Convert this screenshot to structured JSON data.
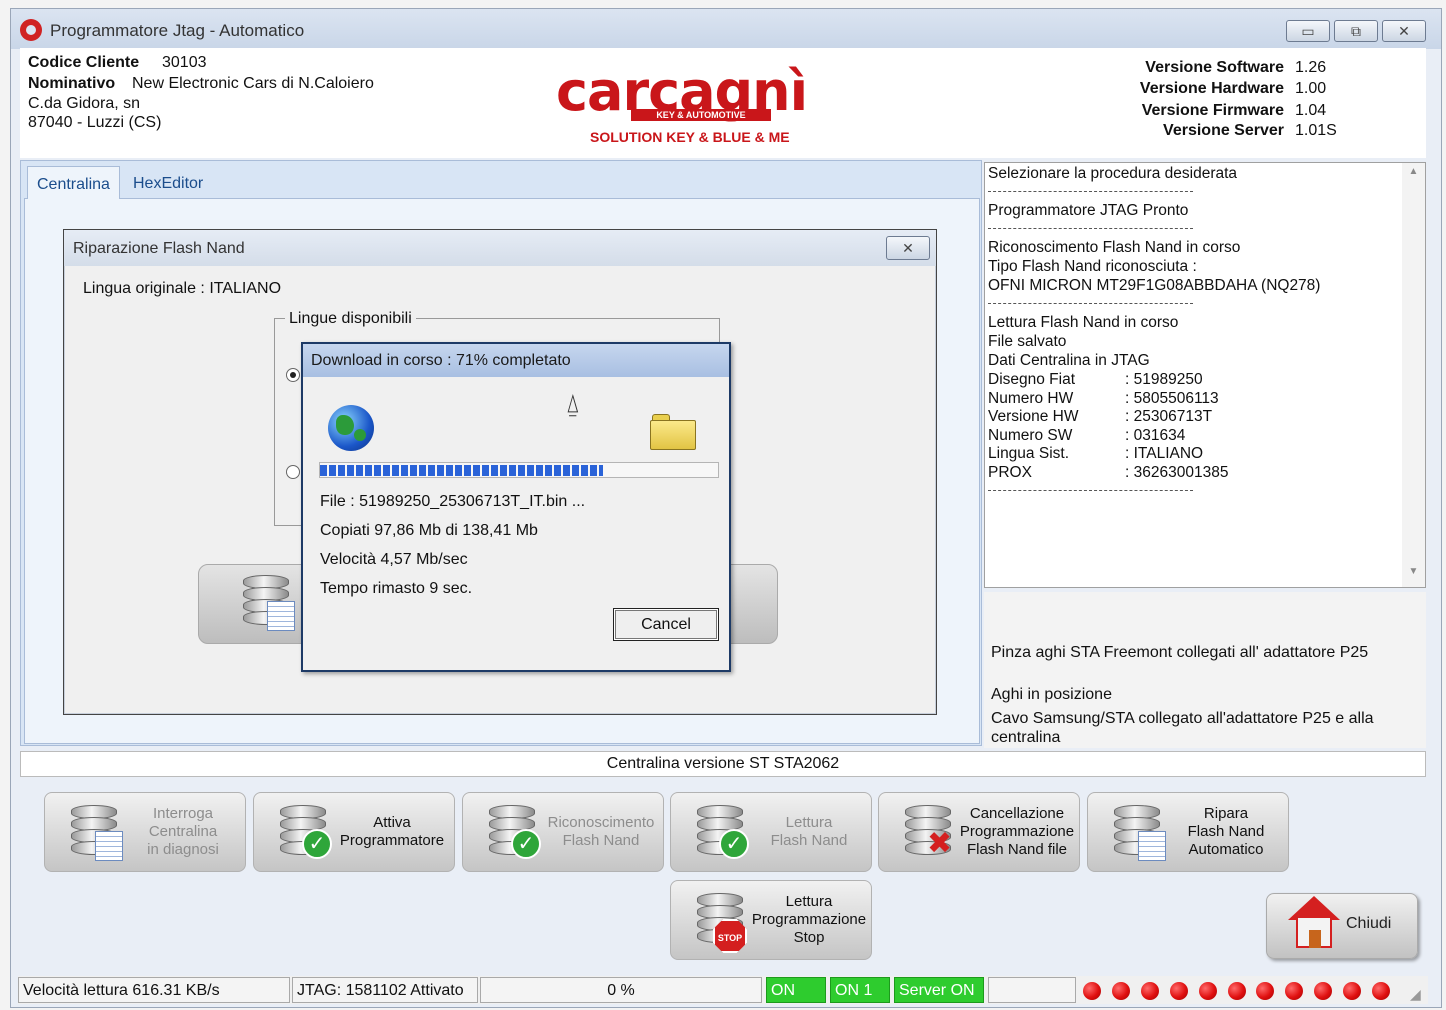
{
  "window": {
    "title": "Programmatore Jtag - Automatico",
    "controls": {
      "minimize": "▭",
      "maximize": "⧉",
      "close": "✕"
    }
  },
  "header": {
    "codice_cliente_label": "Codice Cliente",
    "codice_cliente": "30103",
    "nominativo_label": "Nominativo",
    "nominativo": "New Electronic Cars di N.Caloiero",
    "address_line1": "C.da Gidora, sn",
    "address_line2": "87040 - Luzzi (CS)",
    "logo": {
      "word": "carcagnì",
      "band": "KEY & AUTOMOTIVE",
      "subtitle": "SOLUTION KEY & BLUE & ME",
      "color": "#c9161a"
    },
    "versions": [
      {
        "label": "Versione Software",
        "value": "1.26"
      },
      {
        "label": "Versione Hardware",
        "value": "1.00"
      },
      {
        "label": "Versione Firmware",
        "value": "1.04"
      },
      {
        "label": "Versione Server",
        "value": "1.01S"
      }
    ]
  },
  "tabs": [
    {
      "label": "Centralina",
      "active": true
    },
    {
      "label": "HexEditor",
      "active": false
    }
  ],
  "flash_dialog": {
    "title": "Riparazione Flash Nand",
    "close": "✕",
    "lingua_originale": "Lingua originale : ITALIANO",
    "lingue_disponibili": "Lingue disponibili"
  },
  "download_dialog": {
    "title": "Download in corso : 71% completato",
    "progress_fraction": 0.71,
    "page_glyph": "⍙",
    "file": "File : 51989250_25306713T_IT.bin  ...",
    "copiati": "Copiati 97,86 Mb di 138,41 Mb",
    "velocita": "Velocità 4,57 Mb/sec",
    "tempo": "Tempo rimasto 9 sec.",
    "cancel": "Cancel"
  },
  "log": {
    "lines": [
      {
        "text": "Selezionare la procedura desiderata"
      },
      {
        "sep": true
      },
      {
        "text": "Programmatore JTAG Pronto"
      },
      {
        "sep": true
      },
      {
        "text": "Riconoscimento Flash Nand in corso"
      },
      {
        "text": "Tipo Flash Nand riconosciuta :"
      },
      {
        "text": "OFNI MICRON MT29F1G08ABBDAHA (NQ278)"
      },
      {
        "sep": true
      },
      {
        "text": "Lettura Flash Nand in corso"
      },
      {
        "text": "File salvato"
      },
      {
        "text": "Dati Centralina in JTAG"
      }
    ],
    "fields": [
      {
        "label": "Disegno Fiat",
        "value": ": 51989250"
      },
      {
        "label": "Numero HW",
        "value": ": 5805506113"
      },
      {
        "label": "Versione HW",
        "value": ": 25306713T"
      },
      {
        "label": "Numero SW",
        "value": ": 031634"
      },
      {
        "label": "Lingua Sist.",
        "value": ": ITALIANO"
      },
      {
        "label": "PROX",
        "value": ": 36263001385"
      }
    ],
    "scroll_up": "▲",
    "scroll_down": "▼"
  },
  "info": {
    "line1": "Pinza aghi STA Freemont collegati all' adattatore P25",
    "line2": "Aghi in posizione",
    "line3": "Cavo Samsung/STA collegato all'adattatore P25 e alla",
    "line4": "centralina"
  },
  "centralina_versione": "Centralina versione ST STA2062",
  "buttons": [
    {
      "label": "Interroga\nCentralina\nin diagnosi",
      "enabled": false,
      "badge": "sheet"
    },
    {
      "label": "Attiva\nProgrammatore",
      "enabled": true,
      "badge": "check"
    },
    {
      "label": "Riconoscimento\nFlash Nand",
      "enabled": false,
      "badge": "check"
    },
    {
      "label": "Lettura\nFlash Nand",
      "enabled": false,
      "badge": "check"
    },
    {
      "label": "Cancellazione\nProgrammazione\nFlash Nand file",
      "enabled": true,
      "badge": "cross"
    },
    {
      "label": "Ripara\nFlash Nand\nAutomatico",
      "enabled": true,
      "badge": "sheet"
    },
    {
      "label": "Lettura\nProgrammazione\nStop",
      "enabled": true,
      "badge": "stop"
    }
  ],
  "badge_glyphs": {
    "check": "✓",
    "cross": "✖",
    "stop": "STOP"
  },
  "chiudi": "Chiudi",
  "statusbar": {
    "velocita": "Velocità lettura  616.31 KB/s",
    "jtag": "JTAG: 1581102 Attivato",
    "percent": "0 %",
    "on": "ON",
    "on1": "ON 1",
    "server": "Server ON",
    "led_count": 11,
    "led_color": "#e01010",
    "green": "#2ecc2e",
    "grip": "◢"
  }
}
